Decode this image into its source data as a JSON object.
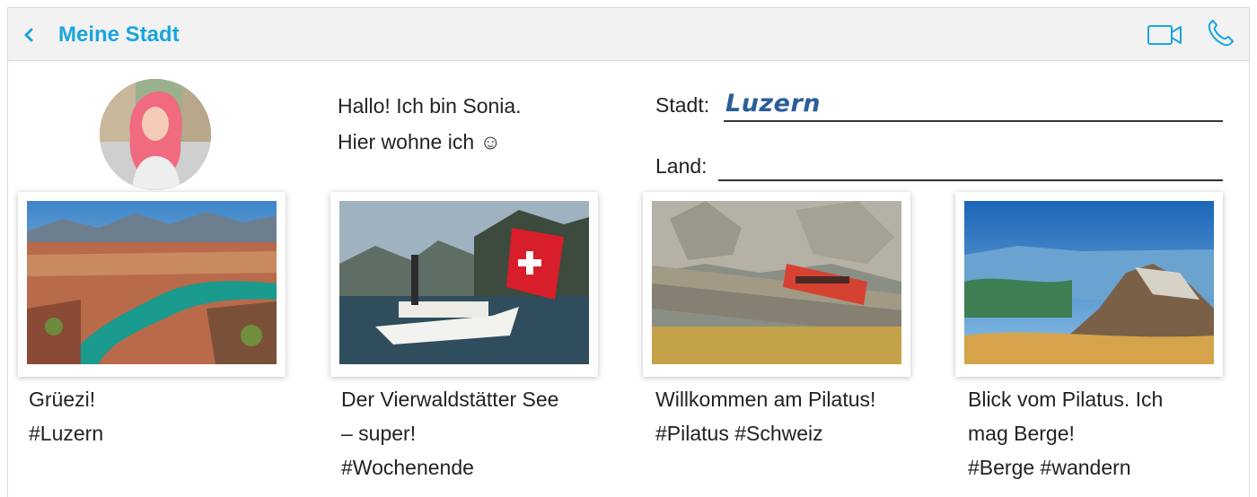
{
  "header": {
    "back_label": "<",
    "title": "Meine Stadt",
    "icons": [
      "video-camera-icon",
      "phone-icon"
    ],
    "accent_color": "#1aa5de"
  },
  "profile": {
    "greeting_line1": "Hallo! Ich bin Sonia.",
    "greeting_line2": "Hier wohne ich ☺"
  },
  "form": {
    "stadt_label": "Stadt:",
    "stadt_value": "Luzern",
    "land_label": "Land:",
    "land_value": ""
  },
  "posts": [
    {
      "line1": "Grüezi!",
      "line2": "#Luzern",
      "line3": ""
    },
    {
      "line1": "Der Vierwaldstätter See",
      "line2": "– super!",
      "line3": "#Wochenende"
    },
    {
      "line1": "Willkommen am Pilatus!",
      "line2": "#Pilatus #Schweiz",
      "line3": ""
    },
    {
      "line1": "Blick vom Pilatus. Ich",
      "line2": "mag Berge!",
      "line3": "#Berge #wandern"
    }
  ]
}
